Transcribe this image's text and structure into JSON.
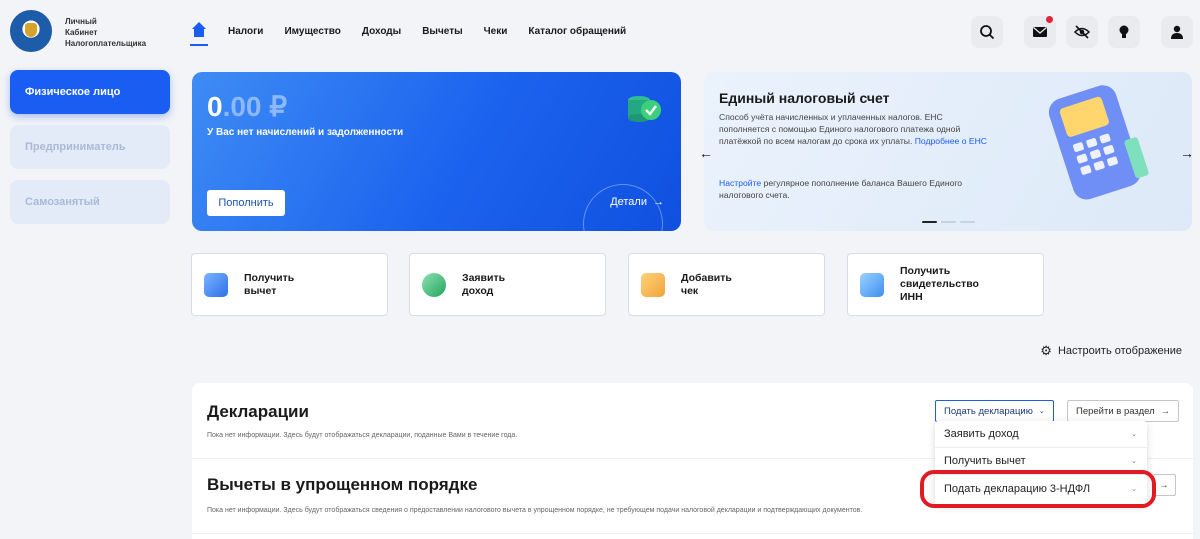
{
  "brand": {
    "line1": "Личный",
    "line2": "Кабинет",
    "line3": "Налогоплательщика"
  },
  "nav": [
    "Налоги",
    "Имущество",
    "Доходы",
    "Вычеты",
    "Чеки",
    "Каталог обращений"
  ],
  "sidebar": [
    {
      "label": "Физическое лицо",
      "active": true
    },
    {
      "label": "Предприниматель",
      "active": false
    },
    {
      "label": "Самозанятый",
      "active": false
    }
  ],
  "balance": {
    "amount_main": "0",
    "amount_rest": ".00 ₽",
    "subtitle": "У Вас нет начислений и задолженности",
    "topup_label": "Пополнить",
    "details_label": "Детали"
  },
  "ens": {
    "title": "Единый налоговый счет",
    "text": "Способ учёта начисленных и уплаченных налогов. ЕНС пополняется с помощью Единого налогового платежа одной платёжкой по всем налогам до срока их уплаты.",
    "more_link": "Подробнее о ЕНС",
    "setup_link": "Настройте",
    "setup_text": "регулярное пополнение баланса Вашего Единого налогового счета."
  },
  "quick_actions": [
    {
      "line1": "Получить",
      "line2": "вычет",
      "line3": ""
    },
    {
      "line1": "Заявить",
      "line2": "доход",
      "line3": ""
    },
    {
      "line1": "Добавить",
      "line2": "чек",
      "line3": ""
    },
    {
      "line1": "Получить",
      "line2": "свидетельство",
      "line3": "ИНН"
    }
  ],
  "configure_label": "Настроить отображение",
  "declarations": {
    "title": "Декларации",
    "note": "Пока нет информации. Здесь будут отображаться декларации, поданные Вами в течение года.",
    "submit_button": "Подать декларацию",
    "goto_button": "Перейти в раздел"
  },
  "deductions": {
    "title": "Вычеты в упрощенном порядке",
    "note": "Пока нет информации. Здесь будут отображаться сведения о предоставлении налогового вычета в упрощенном порядке, не требующем подачи налоговой декларации и подтверждающих документов."
  },
  "dropdown": [
    "Заявить доход",
    "Получить вычет",
    "Подать декларацию 3-НДФЛ"
  ],
  "colors": {
    "primary": "#1a5df3",
    "highlight": "#e01b24"
  }
}
